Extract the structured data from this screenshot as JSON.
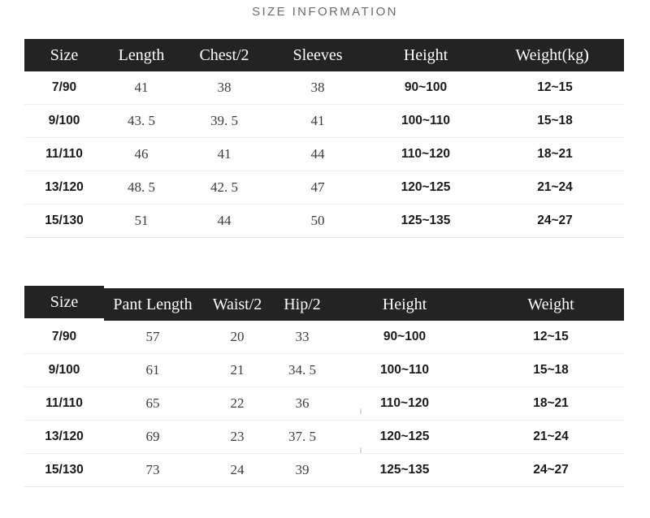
{
  "title": "SIZE INFORMATION",
  "colors": {
    "header_background": "#232323",
    "header_text": "#ffffff",
    "page_background": "#ffffff",
    "row_divider": "#eeeeee",
    "title_text": "#6b6b6b"
  },
  "tables": {
    "top": {
      "name": "top-size-table",
      "headers": {
        "size": "Size",
        "length": "Length",
        "chest": "Chest/2",
        "sleeves": "Sleeves",
        "height": "Height",
        "weight": "Weight(kg)",
        "weight_artifact": ")"
      },
      "rows": [
        {
          "size": "7/90",
          "length": "41",
          "chest": "38",
          "sleeves": "38",
          "height": "90~100",
          "weight": "12~15"
        },
        {
          "size": "9/100",
          "length": "43. 5",
          "chest": "39. 5",
          "sleeves": "41",
          "height": "100~110",
          "weight": "15~18"
        },
        {
          "size": "11/110",
          "length": "46",
          "chest": "41",
          "sleeves": "44",
          "height": "110~120",
          "weight": "18~21"
        },
        {
          "size": "13/120",
          "length": "48. 5",
          "chest": "42. 5",
          "sleeves": "47",
          "height": "120~125",
          "weight": "21~24"
        },
        {
          "size": "15/130",
          "length": "51",
          "chest": "44",
          "sleeves": "50",
          "height": "125~135",
          "weight": "24~27"
        }
      ]
    },
    "bottom": {
      "name": "bottom-size-table",
      "headers": {
        "size": "Size",
        "pant_length": "Pant Length",
        "waist": "Waist/2",
        "hip": "Hip/2",
        "height": "Height",
        "weight": "Weight"
      },
      "rows": [
        {
          "size": "7/90",
          "pant_length": "57",
          "waist": "20",
          "hip": "33",
          "height": "90~100",
          "weight": "12~15"
        },
        {
          "size": "9/100",
          "pant_length": "61",
          "waist": "21",
          "hip": "34. 5",
          "height": "100~110",
          "weight": "15~18"
        },
        {
          "size": "11/110",
          "pant_length": "65",
          "waist": "22",
          "hip": "36",
          "height": "110~120",
          "weight": "18~21"
        },
        {
          "size": "13/120",
          "pant_length": "69",
          "waist": "23",
          "hip": "37. 5",
          "height": "120~125",
          "weight": "21~24"
        },
        {
          "size": "15/130",
          "pant_length": "73",
          "waist": "24",
          "hip": "39",
          "height": "125~135",
          "weight": "24~27"
        }
      ]
    }
  }
}
